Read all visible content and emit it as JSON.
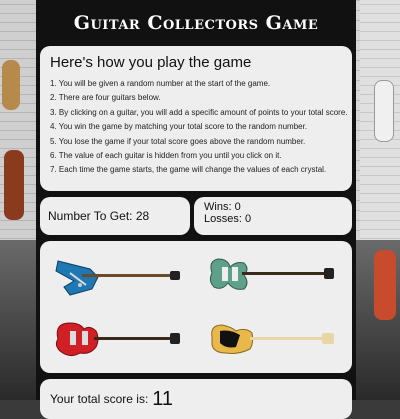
{
  "header": {
    "title": "Guitar Collectors Game"
  },
  "instructions": {
    "heading": "Here's how you play the game",
    "steps": [
      "1. You will be given a random number at the start of the game.",
      "2. There are four guitars below.",
      "3. By clicking on a guitar, you will add a specific amount of points to your total score.",
      "4. You win the game by matching your total score to the random number.",
      "5. You lose the game if your total score goes above the random number.",
      "6. The value of each guitar is hidden from you until you click on it.",
      "7. Each time the game starts, the game will change the values of each crystal."
    ]
  },
  "target": {
    "label": "Number To Get:",
    "value": "28"
  },
  "record": {
    "wins_label": "Wins:",
    "wins": "0",
    "losses_label": "Losses:",
    "losses": "0"
  },
  "guitars": [
    {
      "name": "blue-explorer-guitar",
      "color": "#1e78b4"
    },
    {
      "name": "seafoam-sg-guitar",
      "color": "#5fa08a"
    },
    {
      "name": "red-les-paul-guitar",
      "color": "#d01f25"
    },
    {
      "name": "butterscotch-telecaster-guitar",
      "color": "#e8b94a"
    }
  ],
  "total": {
    "label": "Your total score is:",
    "value": "11"
  }
}
